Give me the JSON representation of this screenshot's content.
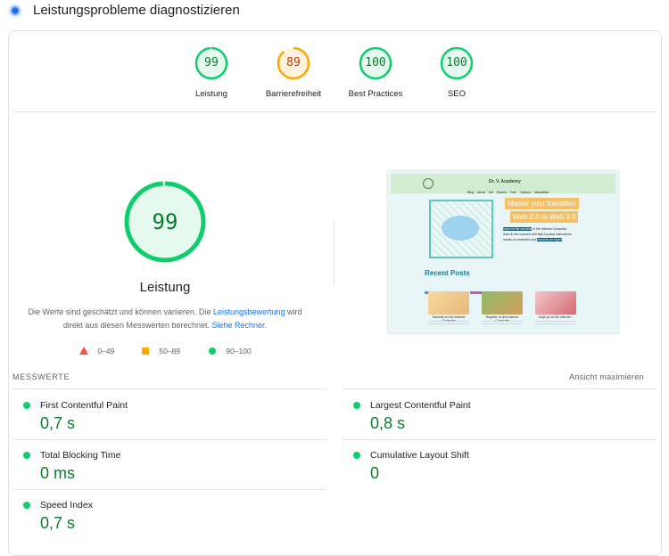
{
  "header": {
    "title": "Leistungsprobleme diagnostizieren"
  },
  "gauges": [
    {
      "score": "99",
      "label": "Leistung",
      "fraction": 0.99,
      "color": "#0cce6b",
      "bg": "#e6f9ee",
      "text": "#0a7c2f"
    },
    {
      "score": "89",
      "label": "Barrierefreiheit",
      "fraction": 0.89,
      "color": "#ffa400",
      "bg": "#fff3e0",
      "text": "#c33300"
    },
    {
      "score": "100",
      "label": "Best Practices",
      "fraction": 1.0,
      "color": "#0cce6b",
      "bg": "#e6f9ee",
      "text": "#0a7c2f"
    },
    {
      "score": "100",
      "label": "SEO",
      "fraction": 1.0,
      "color": "#0cce6b",
      "bg": "#e6f9ee",
      "text": "#0a7c2f"
    }
  ],
  "main": {
    "score": "99",
    "fraction": 0.99,
    "title": "Leistung",
    "desc_part1": "Die Werte sind geschätzt und können variieren. Die ",
    "desc_link1": "Leistungsbewertung",
    "desc_part2": " wird direkt aus diesen Messwerten berechnet. ",
    "desc_link2": "Siehe Rechner",
    "desc_part3": "."
  },
  "legend": {
    "fail": "0–49",
    "average": "50–89",
    "pass": "90–100"
  },
  "screenshot": {
    "brand": "Dr. V. Academy",
    "nav": "Blog About Me Search Free Options Newsletter",
    "banner1": "Master your transition",
    "banner2": "Web 2.0 to Web 3.0",
    "para_highlight": "Improve the success",
    "para_rest": " of the Internet Computer, learn in the courses with step-by-step instructions, hands-on examples and",
    "para_cta": "become an expert",
    "recent": "Recent Posts",
    "cards": [
      "Subnets on the Internet Computer",
      "Register on the Internet Computer",
      "Oisyn.js on the Internet..."
    ]
  },
  "metrics": {
    "label": "MESSWERTE",
    "expand": "Ansicht maximieren",
    "items": [
      {
        "label": "First Contentful Paint",
        "value": "0,7 s"
      },
      {
        "label": "Largest Contentful Paint",
        "value": "0,8 s"
      },
      {
        "label": "Total Blocking Time",
        "value": "0 ms"
      },
      {
        "label": "Cumulative Layout Shift",
        "value": "0"
      },
      {
        "label": "Speed Index",
        "value": "0,7 s"
      }
    ]
  },
  "colors": {
    "pass": "#0cce6b",
    "average": "#ffa400",
    "fail": "#ff4e42",
    "link": "#1a73e8"
  }
}
